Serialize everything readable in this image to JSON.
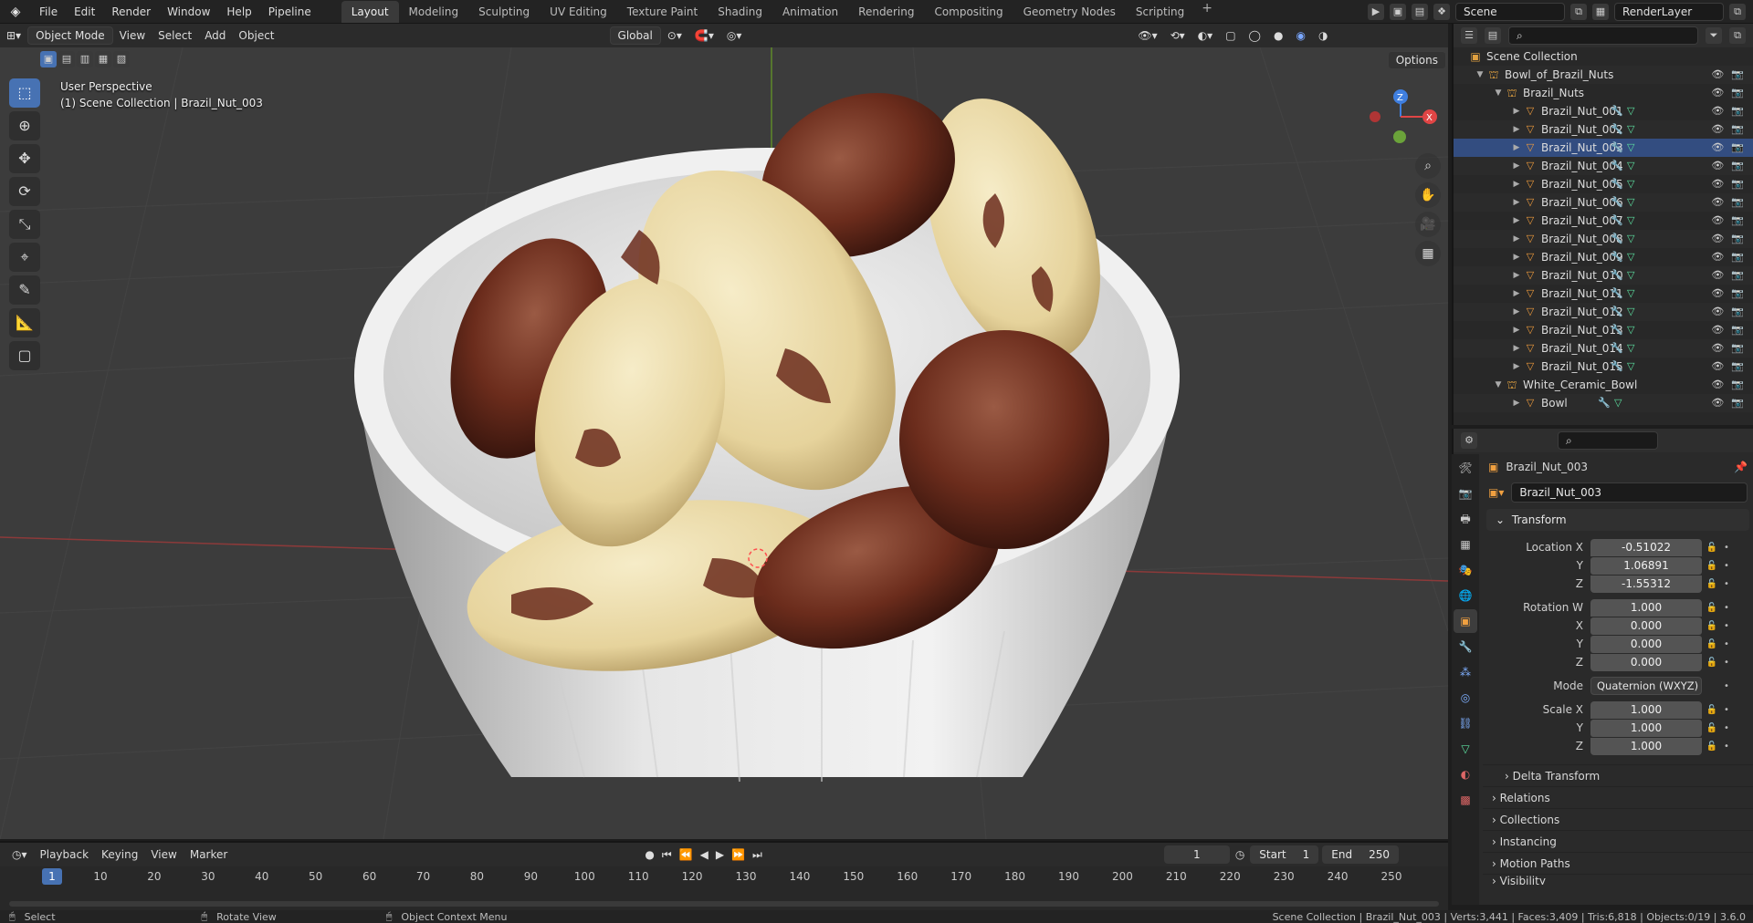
{
  "menu": {
    "logo": "◈",
    "items": [
      "File",
      "Edit",
      "Render",
      "Window",
      "Help",
      "Pipeline"
    ]
  },
  "workspaces": [
    "Layout",
    "Modeling",
    "Sculpting",
    "UV Editing",
    "Texture Paint",
    "Shading",
    "Animation",
    "Rendering",
    "Compositing",
    "Geometry Nodes",
    "Scripting"
  ],
  "workspace_add": "+",
  "top_right": {
    "scene": "Scene",
    "view_layer": "RenderLayer"
  },
  "vp_header": {
    "mode": "Object Mode",
    "menus": [
      "View",
      "Select",
      "Add",
      "Object"
    ],
    "orientation": "Global",
    "options": "Options"
  },
  "viewport": {
    "perspective": "User Perspective",
    "context": "(1) Scene Collection | Brazil_Nut_003",
    "gizmo_z": "Z",
    "gizmo_x": "X",
    "bg_color": "#3c3c3c"
  },
  "outliner": {
    "root": "Scene Collection",
    "bowl_collection": "Bowl_of_Brazil_Nuts",
    "nuts_collection": "Brazil_Nuts",
    "nuts": [
      "Brazil_Nut_001",
      "Brazil_Nut_002",
      "Brazil_Nut_003",
      "Brazil_Nut_004",
      "Brazil_Nut_005",
      "Brazil_Nut_006",
      "Brazil_Nut_007",
      "Brazil_Nut_008",
      "Brazil_Nut_009",
      "Brazil_Nut_010",
      "Brazil_Nut_011",
      "Brazil_Nut_012",
      "Brazil_Nut_013",
      "Brazil_Nut_014",
      "Brazil_Nut_015"
    ],
    "selected": "Brazil_Nut_003",
    "bowl_sub": "White_Ceramic_Bowl",
    "bowl_obj": "Bowl"
  },
  "properties": {
    "object_name": "Brazil_Nut_003",
    "object_field": "Brazil_Nut_003",
    "panel_transform": "Transform",
    "location_label": "Location X",
    "location": [
      "-0.51022",
      "1.06891",
      "-1.55312"
    ],
    "rotation_label": "Rotation W",
    "rotation": [
      "1.000",
      "0.000",
      "0.000",
      "0.000"
    ],
    "mode_label": "Mode",
    "mode_value": "Quaternion (WXYZ)",
    "scale_label": "Scale X",
    "scale": [
      "1.000",
      "1.000",
      "1.000"
    ],
    "axis": {
      "x": "X",
      "y": "Y",
      "z": "Z"
    },
    "subpanels": [
      "Delta Transform",
      "Relations",
      "Collections",
      "Instancing",
      "Motion Paths",
      "Visibility"
    ]
  },
  "timeline": {
    "menus": [
      "Playback",
      "Keying",
      "View",
      "Marker"
    ],
    "current_frame": "1",
    "start_label": "Start",
    "start": "1",
    "end_label": "End",
    "end": "250",
    "ticks": [
      "1",
      "10",
      "20",
      "30",
      "40",
      "50",
      "60",
      "70",
      "80",
      "90",
      "100",
      "110",
      "120",
      "130",
      "140",
      "150",
      "160",
      "170",
      "180",
      "190",
      "200",
      "210",
      "220",
      "230",
      "240",
      "250"
    ]
  },
  "status": {
    "left": "Select",
    "mid": "Rotate View",
    "ctx": "Object Context Menu",
    "right": "Scene Collection | Brazil_Nut_003 | Verts:3,441 | Faces:3,409 | Tris:6,818 | Objects:0/19 | 3.6.0"
  }
}
